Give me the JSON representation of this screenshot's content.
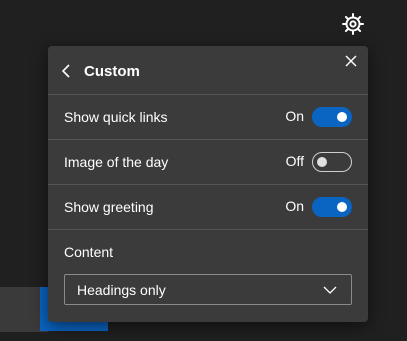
{
  "panel": {
    "title": "Custom",
    "settings": [
      {
        "label": "Show quick links",
        "state": "On",
        "enabled": true
      },
      {
        "label": "Image of the day",
        "state": "Off",
        "enabled": false
      },
      {
        "label": "Show greeting",
        "state": "On",
        "enabled": true
      }
    ],
    "content_label": "Content",
    "content_select_value": "Headings only"
  },
  "icons": {
    "settings": "gear-icon",
    "back": "chevron-left-icon",
    "close": "close-icon",
    "dropdown": "chevron-down-icon"
  },
  "colors": {
    "background": "#202020",
    "panel": "#3b3b3b",
    "accent": "#0a64c2",
    "divider": "#555555"
  }
}
